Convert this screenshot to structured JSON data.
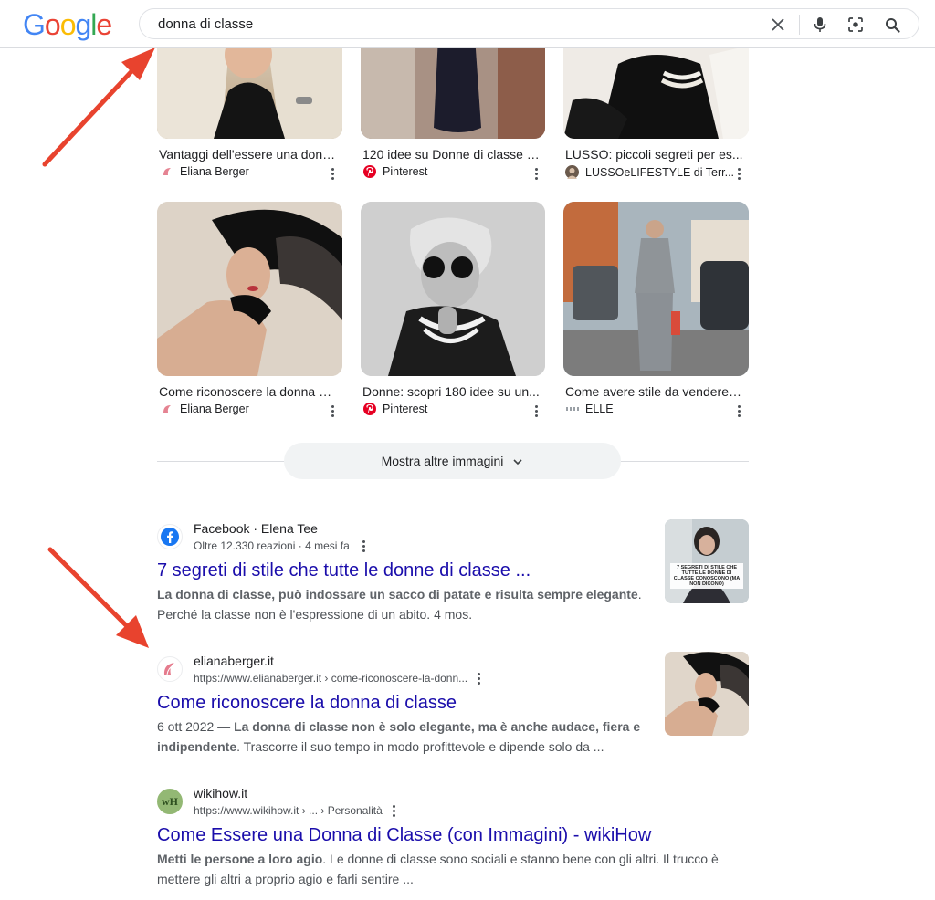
{
  "header": {
    "logo_letters": [
      "G",
      "o",
      "o",
      "g",
      "l",
      "e"
    ],
    "query": "donna di classe"
  },
  "images": [
    {
      "title": "Vantaggi dell'essere una donn...",
      "source": "Eliana Berger",
      "icon": "eliana-logo-icon"
    },
    {
      "title": "120 idee su Donne di classe | ...",
      "source": "Pinterest",
      "icon": "pinterest-icon"
    },
    {
      "title": "LUSSO: piccoli segreti per es...",
      "source": "LUSSOeLIFESTYLE di Terr...",
      "icon": "avatar-icon"
    },
    {
      "title": "Come riconoscere la donna di...",
      "source": "Eliana Berger",
      "icon": "eliana-logo-icon"
    },
    {
      "title": "Donne: scopri 180 idee su un...",
      "source": "Pinterest",
      "icon": "pinterest-icon"
    },
    {
      "title": "Come avere stile da vendere: ...",
      "source": "ELLE",
      "icon": "elle-icon"
    }
  ],
  "more_images_label": "Mostra altre immagini",
  "results": [
    {
      "site": "Facebook · Elena Tee",
      "meta": "Oltre 12.330 reazioni · 4 mesi fa",
      "title": "7 segreti di stile che tutte le donne di classe ...",
      "snippet_bold": "La donna di classe, può indossare un sacco di patate e risulta sempre elegante",
      "snippet_rest": ". Perché la classe non è l'espressione di un abito. 4 mos.",
      "thumb_text": "7 SEGRETI DI STILE CHE TUTTE LE DONNE DI CLASSE CONOSCONO (MA NON DICONO)"
    },
    {
      "site": "elianaberger.it",
      "meta": "https://www.elianaberger.it › come-riconoscere-la-donn...",
      "title": "Come riconoscere la donna di classe",
      "snippet_date": "6 ott 2022 — ",
      "snippet_bold": "La donna di classe non è solo elegante, ma è anche audace, fiera e indipendente",
      "snippet_rest": ". Trascorre il suo tempo in modo profittevole e dipende solo da ..."
    },
    {
      "site": "wikihow.it",
      "meta": "https://www.wikihow.it › ... › Personalità",
      "title": "Come Essere una Donna di Classe (con Immagini) - wikiHow",
      "snippet_bold": "Metti le persone a loro agio",
      "snippet_rest": ". Le donne di classe sono sociali e stanno bene con gli altri. Il trucco è mettere gli altri a proprio agio e farli sentire ...",
      "favicon_text": "wH"
    }
  ],
  "colors": {
    "link": "#1a0dab",
    "annotation_arrow": "#e8432e",
    "pinterest": "#e60023",
    "facebook": "#1877f2"
  }
}
